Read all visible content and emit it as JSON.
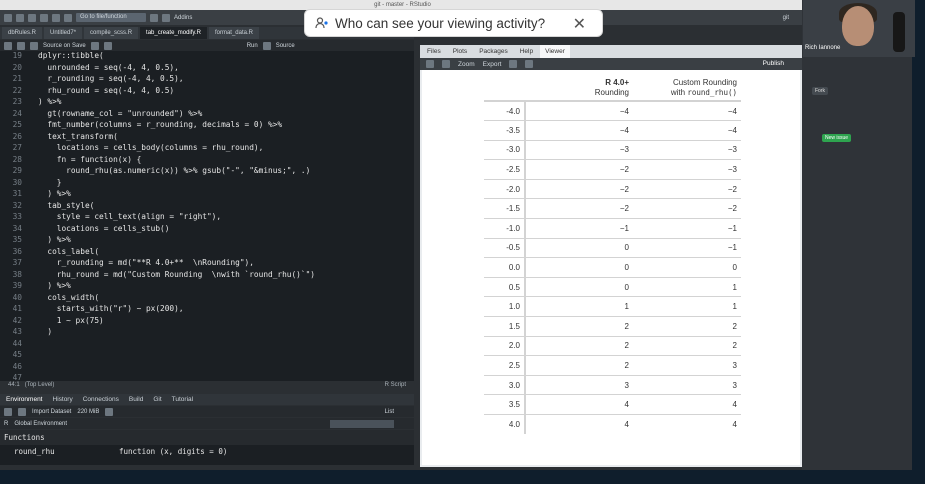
{
  "window": {
    "title": "git - master - RStudio"
  },
  "toolbar": {
    "goto_placeholder": "Go to file/function",
    "addins_label": "Addins",
    "git_label": "git"
  },
  "source_tabs": [
    "dbRules.R",
    "Untitled7*",
    "compile_scss.R",
    "tab_create_modify.R",
    "format_data.R"
  ],
  "source_bar": {
    "source_on_save": "Source on Save",
    "run": "Run",
    "source": "Source"
  },
  "editor": {
    "lines": [
      {
        "n": "19",
        "code": "dplyr::tibble("
      },
      {
        "n": "20",
        "code": "  unrounded = seq(-4, 4, 0.5),"
      },
      {
        "n": "21",
        "code": "  r_rounding = seq(-4, 4, 0.5),"
      },
      {
        "n": "22",
        "code": "  rhu_round = seq(-4, 4, 0.5)"
      },
      {
        "n": "23",
        "code": ") %>%"
      },
      {
        "n": "24",
        "code": "  gt(rowname_col = \"unrounded\") %>%"
      },
      {
        "n": "25",
        "code": "  fmt_number(columns = r_rounding, decimals = 0) %>%"
      },
      {
        "n": "26",
        "code": "  text_transform("
      },
      {
        "n": "27",
        "code": "    locations = cells_body(columns = rhu_round),"
      },
      {
        "n": "28",
        "code": "    fn = function(x) {"
      },
      {
        "n": "29",
        "code": "      round_rhu(as.numeric(x)) %>% gsub(\"-\", \"&minus;\", .)"
      },
      {
        "n": "30",
        "code": "    }"
      },
      {
        "n": "31",
        "code": "  ) %>%"
      },
      {
        "n": "32",
        "code": "  tab_style("
      },
      {
        "n": "33",
        "code": "    style = cell_text(align = \"right\"),"
      },
      {
        "n": "34",
        "code": "    locations = cells_stub()"
      },
      {
        "n": "35",
        "code": "  ) %>%"
      },
      {
        "n": "36",
        "code": "  cols_label("
      },
      {
        "n": "37",
        "code": "    r_rounding = md(\"**R 4.0+**  \\nRounding\"),"
      },
      {
        "n": "38",
        "code": "    rhu_round = md(\"Custom Rounding  \\nwith `round_rhu()`\")"
      },
      {
        "n": "39",
        "code": "  ) %>%"
      },
      {
        "n": "40",
        "code": "  cols_width("
      },
      {
        "n": "41",
        "code": "    starts_with(\"r\") ~ px(200),"
      },
      {
        "n": "42",
        "code": "    1 ~ px(75)"
      },
      {
        "n": "43",
        "code": "  )"
      },
      {
        "n": "44",
        "code": ""
      },
      {
        "n": "45",
        "code": ""
      },
      {
        "n": "46",
        "code": ""
      },
      {
        "n": "47",
        "code": ""
      }
    ],
    "status_pos": "44:1",
    "status_scope": "(Top Level)",
    "status_type": "R Script"
  },
  "env": {
    "tabs": [
      "Environment",
      "History",
      "Connections",
      "Build",
      "Git",
      "Tutorial"
    ],
    "import_label": "Import Dataset",
    "memory_label": "220 MiB",
    "list_label": "List",
    "scope_label": "Global Environment",
    "section": "Functions",
    "rows": [
      {
        "name": "round_rhu",
        "value": "function (x, digits = 0)"
      }
    ]
  },
  "viewer": {
    "tabs": [
      "Files",
      "Plots",
      "Packages",
      "Help",
      "Viewer"
    ],
    "zoom_label": "Zoom",
    "export_label": "Export",
    "publish_label": "Publish"
  },
  "gt_table": {
    "header_r": {
      "bold": "R 4.0+",
      "line2": "Rounding"
    },
    "header_c": {
      "line1": "Custom Rounding",
      "prefix": "with ",
      "code": "round_rhu()"
    },
    "rows": [
      {
        "stub": "-4.0",
        "r": "−4",
        "c": "−4"
      },
      {
        "stub": "-3.5",
        "r": "−4",
        "c": "−4"
      },
      {
        "stub": "-3.0",
        "r": "−3",
        "c": "−3"
      },
      {
        "stub": "-2.5",
        "r": "−2",
        "c": "−3"
      },
      {
        "stub": "-2.0",
        "r": "−2",
        "c": "−2"
      },
      {
        "stub": "-1.5",
        "r": "−2",
        "c": "−2"
      },
      {
        "stub": "-1.0",
        "r": "−1",
        "c": "−1"
      },
      {
        "stub": "-0.5",
        "r": "0",
        "c": "−1"
      },
      {
        "stub": "0.0",
        "r": "0",
        "c": "0"
      },
      {
        "stub": "0.5",
        "r": "0",
        "c": "1"
      },
      {
        "stub": "1.0",
        "r": "1",
        "c": "1"
      },
      {
        "stub": "1.5",
        "r": "2",
        "c": "2"
      },
      {
        "stub": "2.0",
        "r": "2",
        "c": "2"
      },
      {
        "stub": "2.5",
        "r": "2",
        "c": "3"
      },
      {
        "stub": "3.0",
        "r": "3",
        "c": "3"
      },
      {
        "stub": "3.5",
        "r": "4",
        "c": "4"
      },
      {
        "stub": "4.0",
        "r": "4",
        "c": "4"
      }
    ]
  },
  "share_banner": {
    "text": "Who can see your viewing activity?",
    "close": "✕"
  },
  "webcam": {
    "name": "Rich Iannone"
  },
  "right_pane": {
    "fork_label": "Fork",
    "new_issue": "New issue"
  },
  "colors": {
    "editor_bg": "#1b1f23",
    "viewer_bg": "#ffffff",
    "accent_green": "#2ea44f"
  }
}
